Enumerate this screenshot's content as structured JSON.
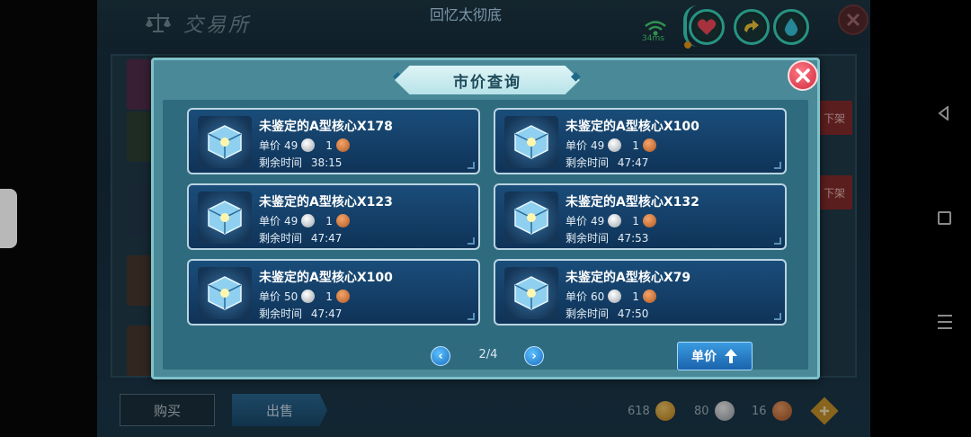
{
  "header": {
    "exchange_title": "交易所",
    "player_name": "回忆太彻底",
    "ping": "34ms"
  },
  "background": {
    "off_shelf_label": "下架",
    "buy_label": "购买",
    "sell_label": "出售",
    "currencies": [
      {
        "amount": "618",
        "icon": "gold-coin-icon"
      },
      {
        "amount": "80",
        "icon": "silver-coin-icon"
      },
      {
        "amount": "16",
        "icon": "copper-coin-icon"
      }
    ]
  },
  "modal": {
    "title": "市价查询",
    "price_label": "单价",
    "time_label": "剩余时间",
    "listings": [
      {
        "name": "未鉴定的A型核心X178",
        "price": "49",
        "copper": "1",
        "time": "38:15"
      },
      {
        "name": "未鉴定的A型核心X100",
        "price": "49",
        "copper": "1",
        "time": "47:47"
      },
      {
        "name": "未鉴定的A型核心X123",
        "price": "49",
        "copper": "1",
        "time": "47:47"
      },
      {
        "name": "未鉴定的A型核心X132",
        "price": "49",
        "copper": "1",
        "time": "47:53"
      },
      {
        "name": "未鉴定的A型核心X100",
        "price": "50",
        "copper": "1",
        "time": "47:47"
      },
      {
        "name": "未鉴定的A型核心X79",
        "price": "60",
        "copper": "1",
        "time": "47:50"
      }
    ],
    "pagination": {
      "current": "2/4"
    },
    "sort_label": "单价",
    "sort_direction": "ascending"
  },
  "colors": {
    "accent": "#3ce2c8",
    "card_bg": "#0f3358",
    "close_red": "#d02a3c"
  }
}
